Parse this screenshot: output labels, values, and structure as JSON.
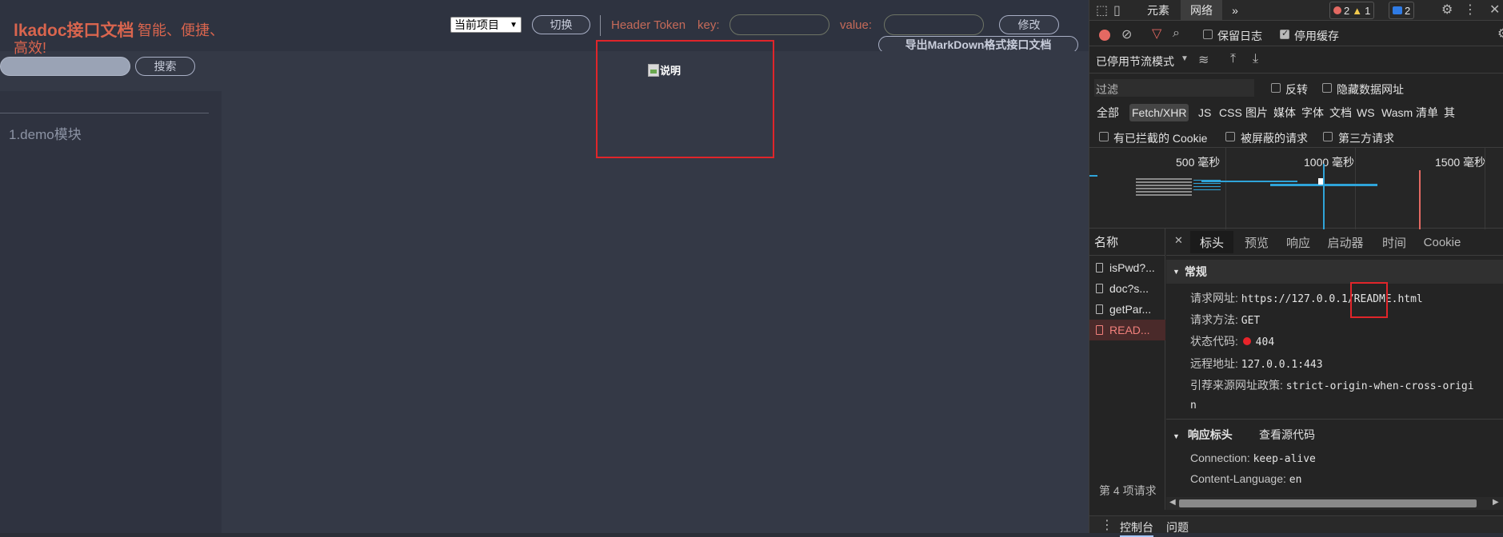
{
  "app": {
    "brand": "lkadoc接口文档",
    "slogan_line1": "智能、便捷、",
    "slogan_line2": "高效!",
    "project_select": "当前项目",
    "switch_button": "切换",
    "header_token_label": "Header Token",
    "key_label": "key:",
    "value_label": "value:",
    "modify_button": "修改",
    "export_button": "导出MarkDown格式接口文档",
    "search_button": "搜索",
    "menu": [
      {
        "label": "1.demo模块"
      }
    ],
    "broken_image_alt": "说明"
  },
  "devtools": {
    "tabs": [
      "元素",
      "网络"
    ],
    "more": "»",
    "badges": {
      "errors": "2",
      "warnings": "1",
      "messages": "2"
    },
    "preserve_log": "保留日志",
    "disable_cache": "停用缓存",
    "throttling": "已停用节流模式",
    "filter_placeholder": "过滤",
    "invert": "反转",
    "hide_data_urls": "隐藏数据网址",
    "type_filters": [
      "全部",
      "Fetch/XHR",
      "JS",
      "CSS",
      "图片",
      "媒体",
      "字体",
      "文档",
      "WS",
      "Wasm",
      "清单",
      "其"
    ],
    "blocked_cookies": "有已拦截的 Cookie",
    "blocked_requests": "被屏蔽的请求",
    "third_party": "第三方请求",
    "timeline_labels": [
      "500 毫秒",
      "1000 毫秒",
      "1500 毫秒"
    ],
    "names_header": "名称",
    "requests": [
      {
        "name": "isPwd?..."
      },
      {
        "name": "doc?s..."
      },
      {
        "name": "getPar..."
      },
      {
        "name": "READ..."
      }
    ],
    "request_count": "第 4 项请求",
    "detail_tabs": [
      "标头",
      "预览",
      "响应",
      "启动器",
      "时间",
      "Cookie"
    ],
    "general_title": "常规",
    "general": {
      "url_label": "请求网址:",
      "url_value": "https://127.0.0.1/README.html",
      "method_label": "请求方法:",
      "method_value": "GET",
      "status_label": "状态代码:",
      "status_value": "404",
      "remote_label": "远程地址:",
      "remote_value": "127.0.0.1:443",
      "referrer_label": "引荐来源网址政策:",
      "referrer_value_1": "strict-origin-when-cross-origi",
      "referrer_value_2": "n"
    },
    "response_headers_title": "响应标头",
    "view_source": "查看源代码",
    "response_headers": [
      {
        "label": "Connection:",
        "value": "keep-alive"
      },
      {
        "label": "Content-Language:",
        "value": "en"
      }
    ],
    "console_tabs": [
      "控制台",
      "问题"
    ],
    "colors": {
      "error": "#f2807c",
      "record": "#e46962",
      "accent": "#a8c7fa"
    }
  }
}
